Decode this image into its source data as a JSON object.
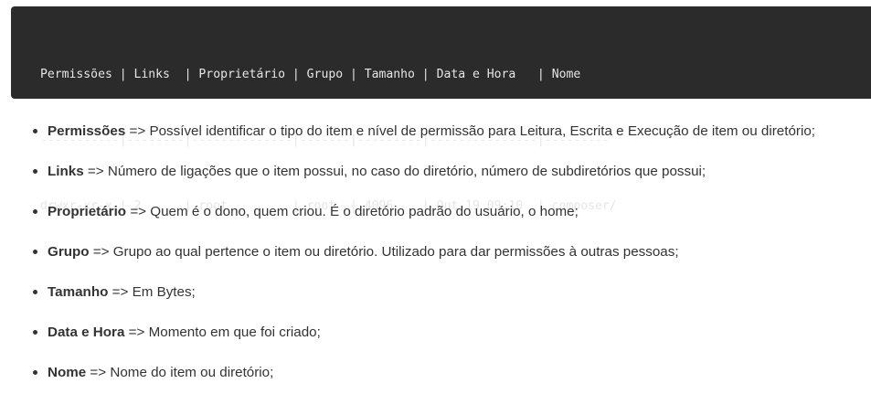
{
  "code_block": {
    "lines": [
      "Permissões | Links  | Proprietário | Grupo | Tamanho | Data e Hora   | Nome",
      "-----------|--------|--------------|-------|---------|---------------|---------",
      "drwxr-xr-x | 2      | root         | root  | 4096    | Out 19 09:10  | composer/"
    ]
  },
  "list": {
    "items": [
      {
        "term": "Permissões",
        "text": " => Possível identificar o tipo do item e nível de permissão para Leitura, Escrita e Execução de item ou diretório;"
      },
      {
        "term": "Links",
        "text": " => Número de ligações que o item possui, no caso do diretório, número de subdiretórios que possui;"
      },
      {
        "term": "Proprietário",
        "text": " => Quem é o dono, quem criou. É o diretório padrão do usuário, o home;"
      },
      {
        "term": "Grupo",
        "text": " => Grupo ao qual pertence o item ou diretório. Utilizado para dar permissões à outras pessoas;"
      },
      {
        "term": "Tamanho",
        "text": " => Em Bytes;"
      },
      {
        "term": "Data e Hora",
        "text": " => Momento em que foi criado;"
      },
      {
        "term": "Nome",
        "text": " => Nome do item ou diretório;"
      }
    ]
  }
}
